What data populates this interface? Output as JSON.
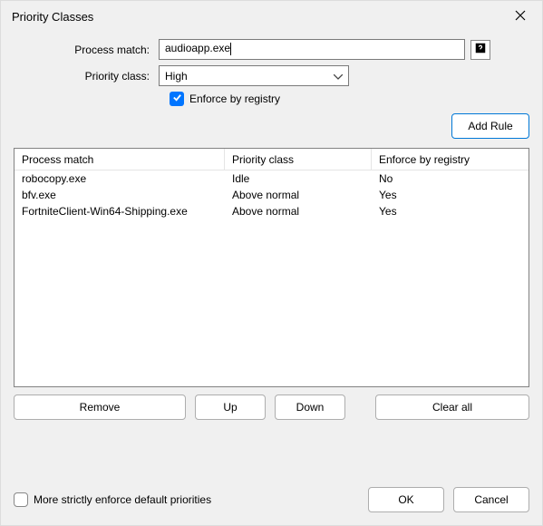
{
  "window": {
    "title": "Priority Classes"
  },
  "form": {
    "process_label": "Process match:",
    "process_value": "audioapp.exe",
    "priority_label": "Priority class:",
    "priority_value": "High",
    "enforce_label": "Enforce by registry",
    "add_rule_label": "Add Rule"
  },
  "table": {
    "headers": {
      "c1": "Process match",
      "c2": "Priority class",
      "c3": "Enforce by registry"
    },
    "rows": [
      {
        "c1": "robocopy.exe",
        "c2": "Idle",
        "c3": "No"
      },
      {
        "c1": "bfv.exe",
        "c2": "Above normal",
        "c3": "Yes"
      },
      {
        "c1": "FortniteClient-Win64-Shipping.exe",
        "c2": "Above normal",
        "c3": "Yes"
      }
    ]
  },
  "buttons": {
    "remove": "Remove",
    "up": "Up",
    "down": "Down",
    "clear_all": "Clear all",
    "ok": "OK",
    "cancel": "Cancel"
  },
  "strict": {
    "label": "More strictly enforce default priorities"
  },
  "colors": {
    "accent": "#0078d7",
    "checkbox": "#0075ff"
  }
}
